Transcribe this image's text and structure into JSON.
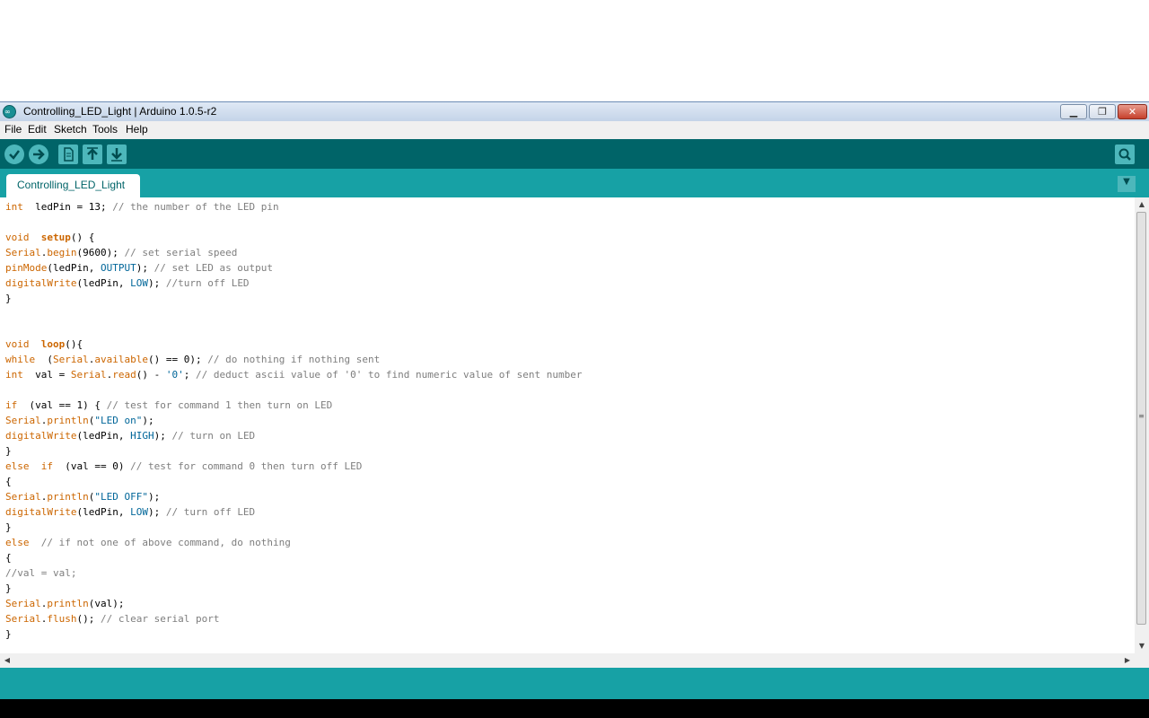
{
  "window": {
    "title": "Controlling_LED_Light | Arduino 1.0.5-r2",
    "icon": "arduino-logo-icon",
    "controls": [
      "minimize-icon",
      "restore-icon",
      "close-icon"
    ]
  },
  "menu": {
    "file": "File",
    "edit": "Edit",
    "sketch": "Sketch",
    "tools": "Tools",
    "help": "Help"
  },
  "toolbar": {
    "buttons": [
      "verify-icon",
      "upload-icon",
      "new-icon",
      "open-icon",
      "save-icon"
    ],
    "right_button": "serial-monitor-icon"
  },
  "tabs": {
    "active": "Controlling_LED_Light",
    "menu_icon": "tab-menu-triangle-icon"
  },
  "colors": {
    "toolbar": "#006468",
    "tabbar": "#17a1a5",
    "keyword": "#cc6600",
    "comment": "#7e7e7e",
    "constant": "#006699"
  },
  "code": {
    "lines": [
      [
        [
          "kw",
          "int"
        ],
        [
          "",
          "  ledPin = 13; "
        ],
        [
          "cm",
          "// the number of the LED pin"
        ]
      ],
      [],
      [
        [
          "kw",
          "void"
        ],
        [
          "",
          "  "
        ],
        [
          "kwb",
          "setup"
        ],
        [
          "",
          "() {"
        ]
      ],
      [
        [
          "kw",
          "Serial"
        ],
        [
          "",
          "."
        ],
        [
          "kw",
          "begin"
        ],
        [
          "",
          "(9600); "
        ],
        [
          "cm",
          "// set serial speed"
        ]
      ],
      [
        [
          "kw",
          "pinMode"
        ],
        [
          "",
          "(ledPin, "
        ],
        [
          "cn",
          "OUTPUT"
        ],
        [
          "",
          "); "
        ],
        [
          "cm",
          "// set LED as output"
        ]
      ],
      [
        [
          "kw",
          "digitalWrite"
        ],
        [
          "",
          "(ledPin, "
        ],
        [
          "cn",
          "LOW"
        ],
        [
          "",
          "); "
        ],
        [
          "cm",
          "//turn off LED"
        ]
      ],
      [
        [
          "",
          "}"
        ]
      ],
      [],
      [],
      [
        [
          "kw",
          "void"
        ],
        [
          "",
          "  "
        ],
        [
          "kwb",
          "loop"
        ],
        [
          "",
          "(){"
        ]
      ],
      [
        [
          "kw",
          "while"
        ],
        [
          "",
          "  ("
        ],
        [
          "kw",
          "Serial"
        ],
        [
          "",
          "."
        ],
        [
          "kw",
          "available"
        ],
        [
          "",
          "() == 0); "
        ],
        [
          "cm",
          "// do nothing if nothing sent"
        ]
      ],
      [
        [
          "kw",
          "int"
        ],
        [
          "",
          "  val = "
        ],
        [
          "kw",
          "Serial"
        ],
        [
          "",
          "."
        ],
        [
          "kw",
          "read"
        ],
        [
          "",
          "() - "
        ],
        [
          "cn",
          "'0'"
        ],
        [
          "",
          "; "
        ],
        [
          "cm",
          "// deduct ascii value of '0' to find numeric value of sent number"
        ]
      ],
      [],
      [
        [
          "kw",
          "if"
        ],
        [
          "",
          "  (val == 1) { "
        ],
        [
          "cm",
          "// test for command 1 then turn on LED"
        ]
      ],
      [
        [
          "kw",
          "Serial"
        ],
        [
          "",
          "."
        ],
        [
          "kw",
          "println"
        ],
        [
          "",
          "("
        ],
        [
          "cn",
          "\"LED on\""
        ],
        [
          "",
          ");"
        ]
      ],
      [
        [
          "kw",
          "digitalWrite"
        ],
        [
          "",
          "(ledPin, "
        ],
        [
          "cn",
          "HIGH"
        ],
        [
          "",
          "); "
        ],
        [
          "cm",
          "// turn on LED"
        ]
      ],
      [
        [
          "",
          "}"
        ]
      ],
      [
        [
          "kw",
          "else"
        ],
        [
          "",
          "  "
        ],
        [
          "kw",
          "if"
        ],
        [
          "",
          "  (val == 0) "
        ],
        [
          "cm",
          "// test for command 0 then turn off LED"
        ]
      ],
      [
        [
          "",
          "{"
        ]
      ],
      [
        [
          "kw",
          "Serial"
        ],
        [
          "",
          "."
        ],
        [
          "kw",
          "println"
        ],
        [
          "",
          "("
        ],
        [
          "cn",
          "\"LED OFF\""
        ],
        [
          "",
          ");"
        ]
      ],
      [
        [
          "kw",
          "digitalWrite"
        ],
        [
          "",
          "(ledPin, "
        ],
        [
          "cn",
          "LOW"
        ],
        [
          "",
          "); "
        ],
        [
          "cm",
          "// turn off LED"
        ]
      ],
      [
        [
          "",
          "}"
        ]
      ],
      [
        [
          "kw",
          "else"
        ],
        [
          "",
          "  "
        ],
        [
          "cm",
          "// if not one of above command, do nothing"
        ]
      ],
      [
        [
          "",
          "{"
        ]
      ],
      [
        [
          "cm",
          "//val = val;"
        ]
      ],
      [
        [
          "",
          "}"
        ]
      ],
      [
        [
          "kw",
          "Serial"
        ],
        [
          "",
          "."
        ],
        [
          "kw",
          "println"
        ],
        [
          "",
          "(val);"
        ]
      ],
      [
        [
          "kw",
          "Serial"
        ],
        [
          "",
          "."
        ],
        [
          "kw",
          "flush"
        ],
        [
          "",
          "(); "
        ],
        [
          "cm",
          "// clear serial port"
        ]
      ],
      [
        [
          "",
          "}"
        ]
      ]
    ]
  }
}
